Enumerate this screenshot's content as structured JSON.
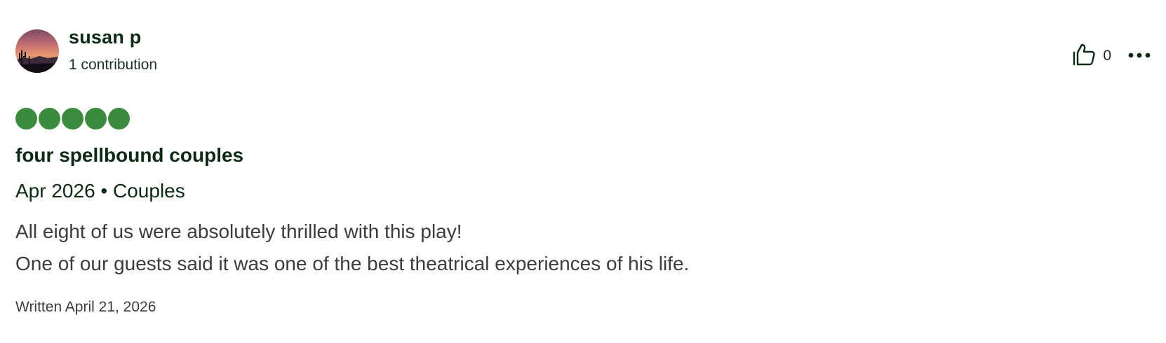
{
  "review": {
    "author": {
      "name": "susan p",
      "contributions": "1 contribution",
      "avatar_icon": "avatar-desert-sunset"
    },
    "helpful_votes": "0",
    "rating": {
      "value": 5,
      "max": 5,
      "color": "#3b8b3f"
    },
    "title": "four spellbound couples",
    "meta": "Apr 2026 • Couples",
    "body_lines": [
      "All eight of us were absolutely thrilled with this play!",
      "One of our guests said it was one of the best theatrical experiences of his life."
    ],
    "written_date": "Written April 21, 2026",
    "icons": {
      "vote": "thumbs-up-icon",
      "more": "more-options-icon"
    }
  }
}
